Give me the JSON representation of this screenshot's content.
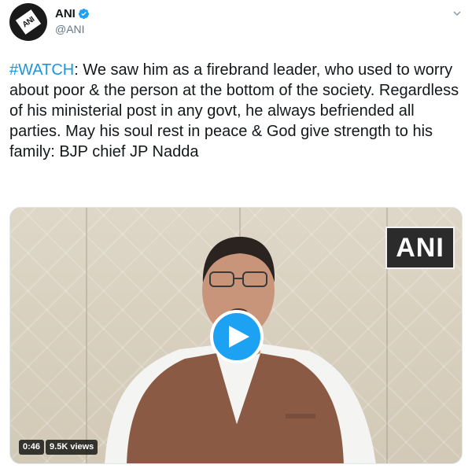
{
  "account": {
    "display_name": "ANI",
    "handle": "@ANI",
    "avatar_text": "ANI"
  },
  "tweet": {
    "hashtag": "#WATCH",
    "body": ": We saw him as a firebrand leader, who used to worry about poor & the person at the bottom of the society. Regardless of his ministerial post in any govt, he always befriended all parties. May his soul rest in peace & God give strength to his family: BJP chief JP Nadda"
  },
  "video": {
    "watermark": "ANI",
    "duration": "0:46",
    "views": "9.5K views"
  },
  "colors": {
    "hashtag": "#1b95e0",
    "verified": "#1da1f2",
    "play_button": "#1da1f2",
    "vest": "#8b5a44",
    "shirt": "#f4f4f2"
  },
  "icons": {
    "verified": "verified-badge-icon",
    "caret": "chevron-down-icon",
    "play": "play-icon"
  }
}
